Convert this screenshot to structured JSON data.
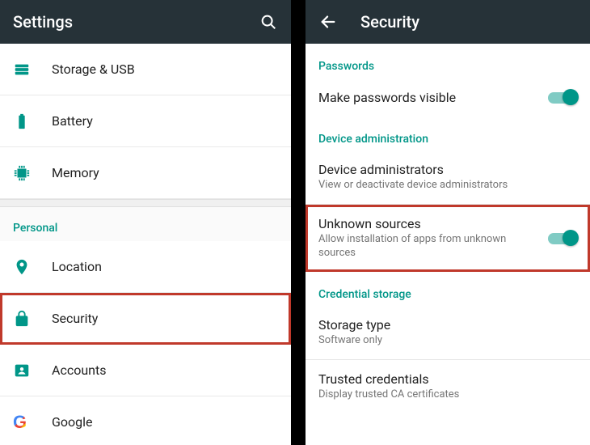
{
  "left": {
    "title": "Settings",
    "items": [
      {
        "label": "Storage & USB"
      },
      {
        "label": "Battery"
      },
      {
        "label": "Memory"
      }
    ],
    "personal_header": "Personal",
    "personal": [
      {
        "label": "Location"
      },
      {
        "label": "Security"
      },
      {
        "label": "Accounts"
      },
      {
        "label": "Google"
      }
    ]
  },
  "right": {
    "title": "Security",
    "sections": {
      "passwords": {
        "header": "Passwords",
        "make_visible": "Make passwords visible"
      },
      "device_admin": {
        "header": "Device administration",
        "admins_title": "Device administrators",
        "admins_sub": "View or deactivate device administrators",
        "unknown_title": "Unknown sources",
        "unknown_sub": "Allow installation of apps from unknown sources"
      },
      "cred": {
        "header": "Credential storage",
        "storage_title": "Storage type",
        "storage_sub": "Software only",
        "trusted_title": "Trusted credentials",
        "trusted_sub": "Display trusted CA certificates"
      }
    }
  }
}
